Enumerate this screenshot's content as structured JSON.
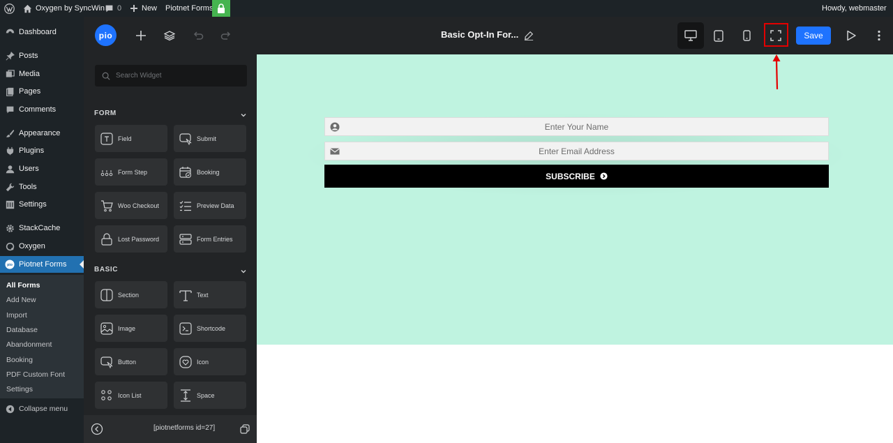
{
  "adminbar": {
    "site_name": "Oxygen by SyncWin",
    "comments_count": "0",
    "new_label": "New",
    "plugin_label": "Piotnet Forms",
    "howdy": "Howdy, webmaster"
  },
  "wp_menu": {
    "items": [
      {
        "label": "Dashboard",
        "icon": "dashboard-icon"
      },
      {
        "label": "Posts",
        "icon": "pin-icon"
      },
      {
        "label": "Media",
        "icon": "media-icon"
      },
      {
        "label": "Pages",
        "icon": "pages-icon"
      },
      {
        "label": "Comments",
        "icon": "comment-icon"
      },
      {
        "label": "Appearance",
        "icon": "brush-icon"
      },
      {
        "label": "Plugins",
        "icon": "plugin-icon"
      },
      {
        "label": "Users",
        "icon": "user-icon"
      },
      {
        "label": "Tools",
        "icon": "wrench-icon"
      },
      {
        "label": "Settings",
        "icon": "settings-icon"
      },
      {
        "label": "StackCache",
        "icon": "gear-icon"
      },
      {
        "label": "Oxygen",
        "icon": "oxygen-icon"
      },
      {
        "label": "Piotnet Forms",
        "icon": "piotnet-icon"
      }
    ],
    "submenu": [
      "All Forms",
      "Add New",
      "Import",
      "Database",
      "Abandonment",
      "Booking",
      "PDF Custom Font",
      "Settings"
    ],
    "collapse_label": "Collapse menu"
  },
  "topbar": {
    "logo_text": "pio",
    "title": "Basic Opt-In For...",
    "save_label": "Save"
  },
  "panel": {
    "search_placeholder": "Search Widget",
    "sections": [
      {
        "title": "FORM",
        "widgets": [
          {
            "label": "Field",
            "icon": "field-icon"
          },
          {
            "label": "Submit",
            "icon": "submit-icon"
          },
          {
            "label": "Form Step",
            "icon": "steps-icon"
          },
          {
            "label": "Booking",
            "icon": "calendar-icon"
          },
          {
            "label": "Woo Checkout",
            "icon": "cart-icon"
          },
          {
            "label": "Preview Data",
            "icon": "list-icon"
          },
          {
            "label": "Lost Password",
            "icon": "lock-icon"
          },
          {
            "label": "Form Entries",
            "icon": "database-icon"
          }
        ]
      },
      {
        "title": "BASIC",
        "widgets": [
          {
            "label": "Section",
            "icon": "section-icon"
          },
          {
            "label": "Text",
            "icon": "text-icon"
          },
          {
            "label": "Image",
            "icon": "image-icon"
          },
          {
            "label": "Shortcode",
            "icon": "shortcode-icon"
          },
          {
            "label": "Button",
            "icon": "button-icon"
          },
          {
            "label": "Icon",
            "icon": "heart-icon"
          },
          {
            "label": "Icon List",
            "icon": "icon-list-icon"
          },
          {
            "label": "Space",
            "icon": "space-icon"
          }
        ]
      }
    ],
    "shortcode": "[piotnetforms id=27]"
  },
  "form": {
    "name_placeholder": "Enter Your Name",
    "email_placeholder": "Enter Email Address",
    "subscribe_label": "SUBSCRIBE"
  },
  "colors": {
    "canvas_bg": "#bff3e0",
    "accent": "#1e73ff",
    "highlight": "#e30000",
    "wp_active": "#2271b1"
  }
}
